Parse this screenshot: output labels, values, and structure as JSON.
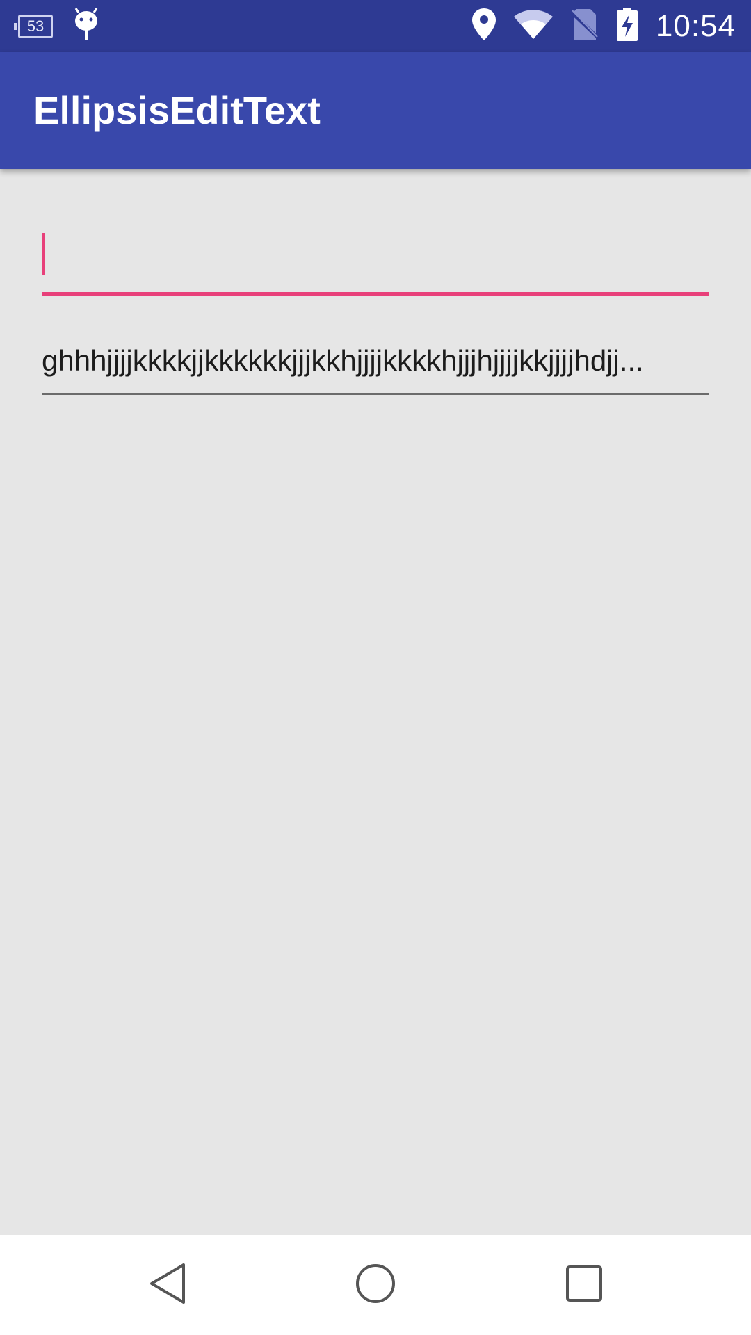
{
  "status_bar": {
    "notification_count": "53",
    "clock": "10:54",
    "background_color": "#2e3a93",
    "icons": [
      "sim-battery-icon",
      "android-icon",
      "location-icon",
      "wifi-icon",
      "no-sim-icon",
      "battery-charging-icon"
    ]
  },
  "app_bar": {
    "title": "EllipsisEditText",
    "background_color": "#3948ab"
  },
  "fields": {
    "first": {
      "value": "",
      "focused": true,
      "accent_color": "#e8407a"
    },
    "second": {
      "value": "ghhhjjjjkkkkjjkkkkkkjjjkkhjjjjkkkkhjjjhjjjjkkjjjjhdjj..."
    }
  },
  "nav_bar": {
    "icons": [
      "back-icon",
      "home-icon",
      "recents-icon"
    ]
  }
}
